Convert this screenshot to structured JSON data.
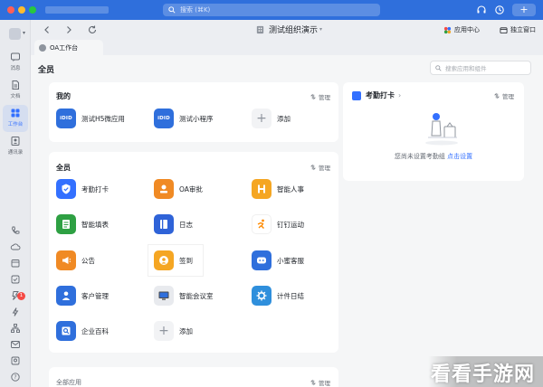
{
  "window": {
    "search_placeholder": "搜索 (⌘K)",
    "add_label": "+"
  },
  "toolbar": {
    "org_title": "测试组织演示",
    "app_center": "应用中心",
    "independent_window": "独立窗口"
  },
  "sidebar": {
    "items": [
      {
        "label": "消息",
        "icon": "message-icon"
      },
      {
        "label": "文档",
        "icon": "document-icon"
      },
      {
        "label": "工作台",
        "icon": "workbench-icon"
      },
      {
        "label": "通讯录",
        "icon": "contacts-icon"
      }
    ],
    "badge_count": "1"
  },
  "tab": {
    "label": "OA工作台"
  },
  "header": {
    "title": "全员",
    "search_placeholder": "搜索应用和组件"
  },
  "my_section": {
    "title": "我的",
    "manage": "管理",
    "apps": [
      {
        "name": "测试H5微应用",
        "icon_text": "iDID"
      },
      {
        "name": "测试小程序",
        "icon_text": "iDID"
      },
      {
        "name": "添加"
      }
    ]
  },
  "all_section": {
    "title": "全员",
    "manage": "管理",
    "apps": [
      {
        "name": "考勤打卡",
        "icon": "attendance-icon",
        "color": "#3370ff"
      },
      {
        "name": "OA审批",
        "icon": "approval-icon",
        "color": "#f08a24"
      },
      {
        "name": "智能人事",
        "icon": "hr-icon",
        "color": "#f5a623"
      },
      {
        "name": "智能填表",
        "icon": "form-icon",
        "color": "#2ea043"
      },
      {
        "name": "日志",
        "icon": "log-icon",
        "color": "#2f63d8"
      },
      {
        "name": "钉钉运动",
        "icon": "sport-icon",
        "color": "#ff8a00"
      },
      {
        "name": "公告",
        "icon": "announcement-icon",
        "color": "#f08a24"
      },
      {
        "name": "签到",
        "icon": "checkin-icon",
        "color": "#f5a623"
      },
      {
        "name": "小蜜客服",
        "icon": "customer-service-icon",
        "color": "#2f6fdc"
      },
      {
        "name": "客户管理",
        "icon": "customer-icon",
        "color": "#2f6fdc"
      },
      {
        "name": "智能会议室",
        "icon": "meeting-room-icon",
        "color": "#4a4a4a"
      },
      {
        "name": "计件日结",
        "icon": "piecework-icon",
        "color": "#2f8fdc"
      },
      {
        "name": "企业百科",
        "icon": "encyclopedia-icon",
        "color": "#2f6fdc"
      },
      {
        "name": "添加"
      }
    ]
  },
  "bottom_section": {
    "title": "全部应用",
    "manage": "管理"
  },
  "attendance_card": {
    "title": "考勤打卡",
    "manage": "管理",
    "message": "您尚未设置考勤组",
    "link": "点击设置"
  },
  "watermark": {
    "text": "看看手游网"
  }
}
